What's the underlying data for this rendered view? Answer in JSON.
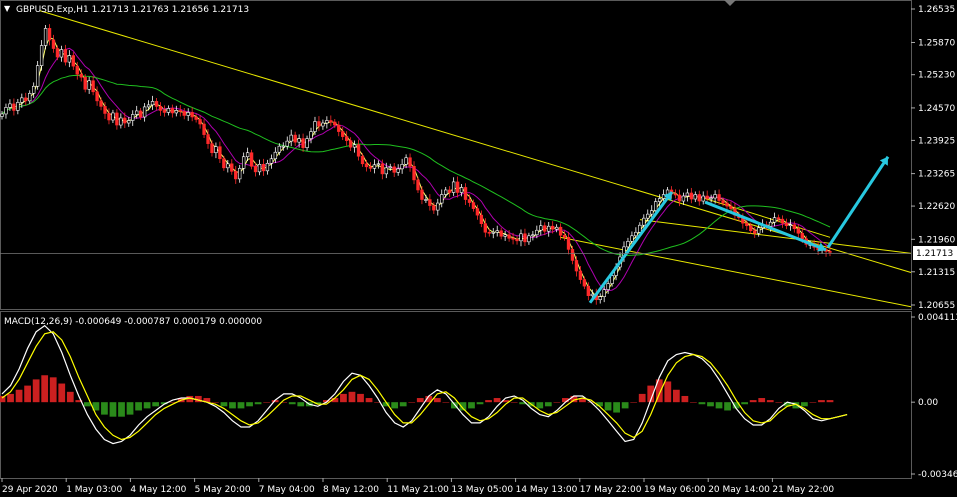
{
  "header": {
    "symbol_line": "GBPUSD.Exp,H1  1.21713 1.21763 1.21656 1.21713"
  },
  "current_price": "1.21713",
  "macd_header": "MACD(12,26,9) -0.000649 -0.000787 0.000179 0.000000",
  "colors": {
    "bull_candle": "#ffffff",
    "bear_candle": "#ff2a2a",
    "ma_fast": "#ffff66",
    "ma_mid": "#b000b0",
    "ma_slow": "#1fbf1f",
    "trendline": "#e8e800",
    "arrow": "#28c8e0",
    "hist_pos": "#cc2020",
    "hist_neg": "#2a8a1a",
    "macd_line": "#ffffff",
    "signal_line": "#ffff00",
    "grid": "#2a2a2a"
  },
  "chart_data": [
    {
      "type": "line",
      "panel": "price",
      "y_ticks": [
        "1.26535",
        "1.25870",
        "1.25230",
        "1.24570",
        "1.23925",
        "1.23265",
        "1.22620",
        "1.21960",
        "1.21315",
        "1.20655"
      ],
      "ylim": [
        1.20655,
        1.26535
      ],
      "x_ticks": [
        "29 Apr 2020",
        "1 May 03:00",
        "4 May 12:00",
        "5 May 20:00",
        "7 May 04:00",
        "8 May 12:00",
        "11 May 21:00",
        "13 May 05:00",
        "14 May 13:00",
        "17 May 22:00",
        "19 May 06:00",
        "20 May 14:00",
        "21 May 22:00"
      ],
      "x": [
        0,
        1,
        2,
        3,
        4,
        5,
        6,
        7,
        8,
        9,
        10,
        11,
        12,
        13,
        14,
        15,
        16,
        17,
        18,
        19,
        20,
        21,
        22,
        23,
        24,
        25,
        26,
        27,
        28,
        29,
        30,
        31,
        32,
        33,
        34,
        35,
        36,
        37,
        38,
        39,
        40,
        41,
        42,
        43,
        44,
        45,
        46,
        47,
        48,
        49,
        50,
        51,
        52,
        53,
        54,
        55,
        56,
        57,
        58,
        59,
        60,
        61,
        62,
        63,
        64,
        65,
        66,
        67,
        68,
        69,
        70,
        71,
        72,
        73,
        74,
        75,
        76,
        77,
        78,
        79,
        80,
        81,
        82,
        83,
        84,
        85,
        86,
        87,
        88,
        89,
        90,
        91,
        92,
        93,
        94,
        95,
        96,
        97,
        98,
        99,
        100,
        101,
        102,
        103,
        104,
        105,
        106,
        107,
        108,
        109,
        110,
        111,
        112,
        113,
        114,
        115,
        116,
        117,
        118,
        119,
        120,
        121,
        122,
        123,
        124,
        125,
        126,
        127,
        128,
        129,
        130,
        131,
        132,
        133,
        134,
        135,
        136,
        137,
        138,
        139,
        140,
        141,
        142,
        143,
        144,
        145,
        146,
        147,
        148,
        149,
        150,
        151,
        152,
        153,
        154,
        155,
        156,
        157,
        158,
        159,
        160,
        161,
        162,
        163,
        164,
        165,
        166,
        167,
        168,
        169,
        170,
        171,
        172,
        173,
        174,
        175,
        176,
        177,
        178,
        179,
        180,
        181,
        182,
        183,
        184,
        185,
        186,
        187,
        188,
        189,
        190,
        191,
        192,
        193,
        194,
        195,
        196,
        197,
        198,
        199,
        200,
        201,
        202,
        203,
        204,
        205,
        206,
        207,
        208,
        209,
        210,
        211,
        212,
        213,
        214,
        215,
        216,
        217,
        218,
        219,
        220,
        221,
        222,
        223,
        224,
        225,
        226,
        227,
        228,
        229,
        230,
        231,
        232,
        233,
        234,
        235,
        236,
        237,
        238,
        239,
        240,
        241,
        242,
        243,
        244,
        245,
        246,
        247,
        248,
        249,
        250,
        251,
        252,
        253,
        254,
        255,
        256,
        257,
        258,
        259,
        260,
        261,
        262,
        263,
        264,
        265,
        266,
        267,
        268,
        269,
        270,
        271,
        272,
        273,
        274,
        275,
        276,
        277,
        278,
        279,
        280,
        281,
        282,
        283,
        284,
        285,
        286,
        287,
        288,
        289,
        290,
        291,
        292,
        293,
        294,
        295,
        296,
        297,
        298,
        299
      ],
      "close": [
        1.2445,
        1.2458,
        1.2465,
        1.2452,
        1.2468,
        1.2477,
        1.2471,
        1.2486,
        1.25,
        1.2541,
        1.2581,
        1.2615,
        1.2592,
        1.2575,
        1.2558,
        1.2573,
        1.2548,
        1.2561,
        1.254,
        1.2524,
        1.2518,
        1.2494,
        1.2511,
        1.2489,
        1.2471,
        1.246,
        1.2446,
        1.2433,
        1.2447,
        1.2423,
        1.2437,
        1.2427,
        1.2432,
        1.2444,
        1.2451,
        1.2439,
        1.2459,
        1.2463,
        1.247,
        1.246,
        1.2452,
        1.2448,
        1.2456,
        1.2447,
        1.2452,
        1.245,
        1.2442,
        1.2448,
        1.2439,
        1.2434,
        1.2425,
        1.2404,
        1.2386,
        1.2368,
        1.238,
        1.2356,
        1.2338,
        1.2346,
        1.2331,
        1.2316,
        1.2337,
        1.236,
        1.2368,
        1.2341,
        1.233,
        1.2345,
        1.2332,
        1.2347,
        1.2356,
        1.2369,
        1.2381,
        1.2381,
        1.2391,
        1.2403,
        1.2389,
        1.2396,
        1.2378,
        1.2396,
        1.241,
        1.243,
        1.2421,
        1.2427,
        1.2432,
        1.2429,
        1.2423,
        1.241,
        1.24,
        1.2392,
        1.2379,
        1.2384,
        1.2361,
        1.2346,
        1.234,
        1.2337,
        1.2344,
        1.2346,
        1.2326,
        1.2338,
        1.234,
        1.2329,
        1.2336,
        1.2345,
        1.2358,
        1.2341,
        1.2314,
        1.2294,
        1.2275,
        1.2275,
        1.2263,
        1.2254,
        1.2268,
        1.2285,
        1.2294,
        1.2289,
        1.231,
        1.2289,
        1.2299,
        1.2275,
        1.2269,
        1.2257,
        1.2244,
        1.2227,
        1.221,
        1.2209,
        1.221,
        1.2213,
        1.2202,
        1.2205,
        1.2198,
        1.2196,
        1.2193,
        1.2207,
        1.2191,
        1.2203,
        1.2205,
        1.2214,
        1.2223,
        1.2212,
        1.2222,
        1.2216,
        1.222,
        1.2204,
        1.22,
        1.2176,
        1.2154,
        1.2133,
        1.2116,
        1.2103,
        1.2084,
        1.2087,
        1.2076,
        1.2082,
        1.2096,
        1.2108,
        1.2124,
        1.2141,
        1.2161,
        1.2181,
        1.2192,
        1.2203,
        1.221,
        1.2224,
        1.2238,
        1.2246,
        1.2253,
        1.2271,
        1.2277,
        1.2285,
        1.2294,
        1.2286,
        1.2284,
        1.2272,
        1.2282,
        1.2288,
        1.2276,
        1.2285,
        1.2272,
        1.2282,
        1.2277,
        1.2278,
        1.2285,
        1.2273,
        1.2268,
        1.2262,
        1.2257,
        1.2244,
        1.2239,
        1.2228,
        1.2223,
        1.2213,
        1.2208,
        1.2219,
        1.2225,
        1.2222,
        1.223,
        1.2239,
        1.2236,
        1.2228,
        1.2223,
        1.2225,
        1.2217,
        1.2208,
        1.2197,
        1.2186,
        1.2186,
        1.218,
        1.2175,
        1.2176,
        1.2172,
        1.2171
      ],
      "series": [
        {
          "name": "",
          "values": []
        }
      ]
    },
    {
      "type": "bar",
      "panel": "macd",
      "y_ticks": [
        "0.004113",
        "0.00",
        "-0.003468"
      ],
      "ylim": [
        -0.003468,
        0.004113
      ],
      "histogram": [
        0.0003,
        0.0004,
        0.0006,
        0.0008,
        0.0011,
        0.0013,
        0.0012,
        0.0009,
        0.0005,
        0.0001,
        -0.0002,
        -0.0004,
        -0.0006,
        -0.0007,
        -0.0007,
        -0.0006,
        -0.0004,
        -0.0003,
        -0.0002,
        -0.0001,
        0.0,
        0.0002,
        0.0003,
        0.0003,
        0.0002,
        0.0,
        -0.0002,
        -0.0003,
        -0.0003,
        -0.0002,
        -0.0001,
        0.0,
        0.0001,
        0.0,
        -0.0001,
        -0.0002,
        -0.0002,
        -0.0001,
        0.0001,
        0.0002,
        0.0004,
        0.0005,
        0.0004,
        0.0002,
        0.0,
        -0.0002,
        -0.0003,
        -0.0002,
        0.0,
        0.0002,
        0.0003,
        0.0002,
        0.0,
        -0.0003,
        -0.0004,
        -0.0003,
        -0.0001,
        0.0001,
        0.0002,
        0.0001,
        0.0,
        -0.0001,
        -0.0002,
        -0.0003,
        -0.0002,
        0.0,
        0.0002,
        0.0003,
        0.0002,
        0.0,
        -0.0002,
        -0.0004,
        -0.0005,
        -0.0003,
        0.0,
        0.0004,
        0.0008,
        0.0011,
        0.001,
        0.0006,
        0.0003,
        0.0,
        -0.0001,
        -0.0002,
        -0.0003,
        -0.0004,
        -0.0003,
        -0.0001,
        0.0001,
        0.0002,
        0.0001,
        0.0,
        -0.0002,
        -0.0003,
        -0.0002,
        0.0,
        0.0001,
        0.0001
      ],
      "macd": [
        0.0004,
        0.0008,
        0.0016,
        0.0026,
        0.0034,
        0.0037,
        0.0033,
        0.0024,
        0.0013,
        0.0003,
        -0.0006,
        -0.0013,
        -0.0018,
        -0.002,
        -0.0019,
        -0.0016,
        -0.0011,
        -0.0007,
        -0.0004,
        -0.0001,
        0.0001,
        0.0002,
        0.0002,
        0.0001,
        0.0,
        -0.0002,
        -0.0005,
        -0.0009,
        -0.0012,
        -0.0012,
        -0.0009,
        -0.0004,
        0.0001,
        0.0004,
        0.0004,
        0.0002,
        -0.0001,
        -0.0002,
        0.0,
        0.0004,
        0.001,
        0.0014,
        0.0013,
        0.0008,
        0.0002,
        -0.0005,
        -0.001,
        -0.0012,
        -0.0009,
        -0.0003,
        0.0003,
        0.0006,
        0.0004,
        -0.0001,
        -0.0006,
        -0.001,
        -0.001,
        -0.0007,
        -0.0002,
        0.0002,
        0.0003,
        0.0001,
        -0.0003,
        -0.0006,
        -0.0007,
        -0.0004,
        0.0,
        0.0003,
        0.0003,
        0.0,
        -0.0004,
        -0.0009,
        -0.0014,
        -0.0019,
        -0.0018,
        -0.001,
        0.0001,
        0.0012,
        0.002,
        0.0023,
        0.0024,
        0.0023,
        0.0021,
        0.0017,
        0.0011,
        0.0004,
        -0.0003,
        -0.0008,
        -0.0011,
        -0.0011,
        -0.0008,
        -0.0003,
        0.0,
        -0.0001,
        -0.0004,
        -0.0008,
        -0.0009,
        -0.0008,
        -0.0007,
        -0.0006
      ],
      "signal": [
        0.0002,
        0.0005,
        0.0011,
        0.0019,
        0.0027,
        0.0033,
        0.0034,
        0.003,
        0.0022,
        0.0012,
        0.0003,
        -0.0006,
        -0.0012,
        -0.0016,
        -0.0018,
        -0.0017,
        -0.0014,
        -0.001,
        -0.0006,
        -0.0003,
        -0.0001,
        0.0001,
        0.0002,
        0.0001,
        0.0,
        -0.0001,
        -0.0003,
        -0.0006,
        -0.0009,
        -0.0011,
        -0.001,
        -0.0007,
        -0.0003,
        0.0001,
        0.0003,
        0.0003,
        0.0001,
        -0.0001,
        -0.0001,
        0.0002,
        0.0006,
        0.0011,
        0.0013,
        0.0011,
        0.0006,
        0.0,
        -0.0006,
        -0.001,
        -0.001,
        -0.0006,
        -0.0001,
        0.0004,
        0.0005,
        0.0002,
        -0.0003,
        -0.0007,
        -0.0009,
        -0.0008,
        -0.0005,
        -0.0001,
        0.0002,
        0.0002,
        -0.0001,
        -0.0004,
        -0.0006,
        -0.0005,
        -0.0002,
        0.0001,
        0.0002,
        0.0001,
        -0.0002,
        -0.0006,
        -0.001,
        -0.0015,
        -0.0017,
        -0.0014,
        -0.0006,
        0.0004,
        0.0013,
        0.0019,
        0.0022,
        0.0023,
        0.0022,
        0.0019,
        0.0014,
        0.0008,
        0.0001,
        -0.0005,
        -0.0009,
        -0.001,
        -0.0009,
        -0.0005,
        -0.0002,
        -0.0001,
        -0.0003,
        -0.0006,
        -0.0008,
        -0.0008,
        -0.0007,
        -0.0006
      ]
    }
  ]
}
